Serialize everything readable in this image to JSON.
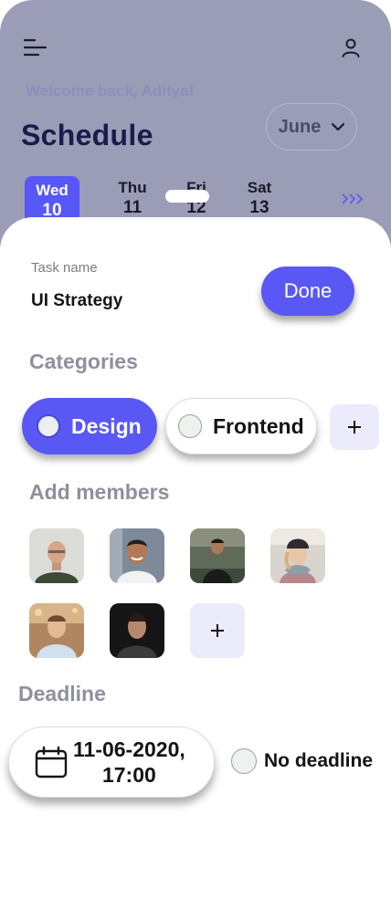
{
  "header": {
    "menu_icon": "menu-icon",
    "profile_icon": "user-icon",
    "welcome": "Welcome back, Aditya!",
    "title": "Schedule",
    "month": "June",
    "month_icon": "chevron-down-icon"
  },
  "calendar": {
    "days": [
      {
        "name": "Wed",
        "num": "10",
        "active": true
      },
      {
        "name": "Thu",
        "num": "11",
        "active": false
      },
      {
        "name": "Fri",
        "num": "12",
        "active": false
      },
      {
        "name": "Sat",
        "num": "13",
        "active": false
      }
    ],
    "more_icon": "chevrons-right-icon"
  },
  "task": {
    "label": "Task name",
    "value": "UI Strategy",
    "done": "Done"
  },
  "categories": {
    "title": "Categories",
    "items": [
      {
        "label": "Design",
        "selected": true
      },
      {
        "label": "Frontend",
        "selected": false
      }
    ],
    "add_icon": "plus-icon"
  },
  "members": {
    "title": "Add members",
    "avatars": [
      "member-1",
      "member-2",
      "member-3",
      "member-4",
      "member-5",
      "member-6"
    ],
    "add_icon": "plus-icon"
  },
  "deadline": {
    "title": "Deadline",
    "date": "11-06-2020,",
    "time": "17:00",
    "icon": "calendar-icon",
    "no_deadline": "No deadline"
  },
  "colors": {
    "accent": "#5a58f5",
    "header_bg": "#9b9cb6",
    "title": "#1c1b4d",
    "section": "#8e909b"
  }
}
